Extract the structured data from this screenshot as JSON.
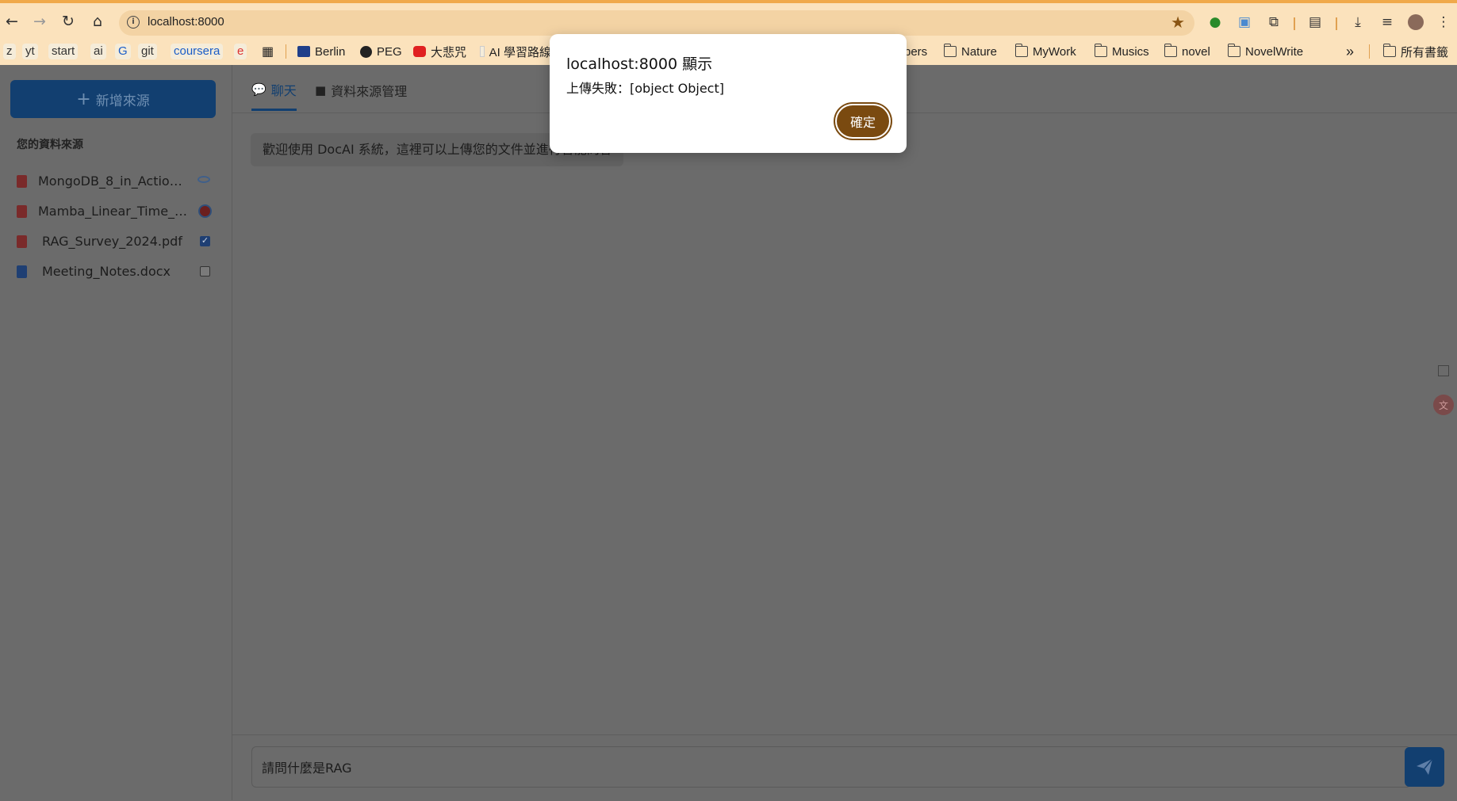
{
  "browser": {
    "url": "localhost:8000",
    "bookmarks": {
      "chips": [
        "z",
        "yt",
        "start",
        "ai",
        "G",
        "git",
        "coursera",
        "e"
      ],
      "items": [
        "Berlin",
        "PEG",
        "大悲咒",
        "AI 學習路線"
      ],
      "folders": [
        "pers",
        "Nature",
        "MyWork",
        "Musics",
        "novel",
        "NovelWrite"
      ],
      "more": "»",
      "all_bookmarks": "所有書籤"
    }
  },
  "app": {
    "add_source_label": "新增來源",
    "sources_title": "您的資料來源",
    "sources": [
      {
        "name": "MongoDB_8_in_Action_...",
        "type": "pdf",
        "status": "loading"
      },
      {
        "name": "Mamba_Linear_Time_Se...",
        "type": "pdf",
        "status": "error"
      },
      {
        "name": "RAG_Survey_2024.pdf",
        "type": "pdf",
        "status": "checked"
      },
      {
        "name": "Meeting_Notes.docx",
        "type": "docx",
        "status": "unchecked"
      }
    ],
    "tabs": [
      {
        "label": "聊天",
        "active": true
      },
      {
        "label": "資料來源管理",
        "active": false
      }
    ],
    "welcome_message": "歡迎使用 DocAI 系統，這裡可以上傳您的文件並進行智能問答",
    "input_value": "請問什麼是RAG"
  },
  "dialog": {
    "title": "localhost:8000 顯示",
    "message": "上傳失敗：[object Object]",
    "ok_label": "確定"
  },
  "colors": {
    "accent": "#123f70",
    "dialog_button": "#7a4a10",
    "chrome_bg": "#fbe2bc",
    "overlay_bg": "#6b6b6b"
  }
}
